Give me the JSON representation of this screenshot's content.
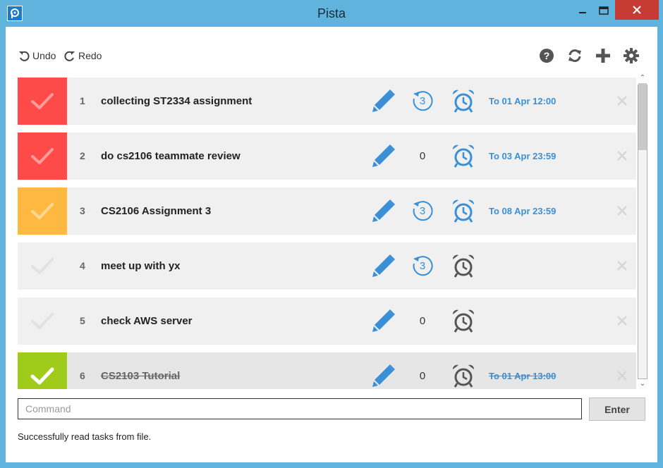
{
  "window": {
    "title": "Pista"
  },
  "toolbar": {
    "undo_label": "Undo",
    "redo_label": "Redo",
    "icons": [
      "help-icon",
      "refresh-icon",
      "add-icon",
      "settings-icon"
    ]
  },
  "colors": {
    "accent": "#3a8fd6",
    "priority_high": "#ff4a4a",
    "priority_medium": "#ffb940",
    "complete": "#9fcb1b",
    "alarm_active": "#3a8fd6",
    "alarm_inactive": "#555555"
  },
  "tasks": [
    {
      "index": "1",
      "name": "collecting ST2334 assignment",
      "priority": "high",
      "recurrence": "3",
      "recurring": true,
      "alarm": true,
      "deadline": "To 01 Apr 12:00",
      "done": false
    },
    {
      "index": "2",
      "name": "do cs2106 teammate review",
      "priority": "high",
      "recurrence": "0",
      "recurring": false,
      "alarm": true,
      "deadline": "To 03 Apr 23:59",
      "done": false
    },
    {
      "index": "3",
      "name": "CS2106 Assignment 3",
      "priority": "medium",
      "recurrence": "3",
      "recurring": true,
      "alarm": true,
      "deadline": "To 08 Apr 23:59",
      "done": false
    },
    {
      "index": "4",
      "name": "meet up with yx",
      "priority": "none",
      "recurrence": "3",
      "recurring": true,
      "alarm": false,
      "deadline": "",
      "done": false
    },
    {
      "index": "5",
      "name": "check AWS server",
      "priority": "none",
      "recurrence": "0",
      "recurring": false,
      "alarm": false,
      "deadline": "",
      "done": false
    },
    {
      "index": "6",
      "name": "CS2103 Tutorial",
      "priority": "complete",
      "recurrence": "0",
      "recurring": false,
      "alarm": false,
      "deadline": "To 01 Apr 13:00",
      "done": true
    }
  ],
  "command": {
    "placeholder": "Command",
    "value": ""
  },
  "enter_label": "Enter",
  "status_message": "Successfully read tasks from file."
}
